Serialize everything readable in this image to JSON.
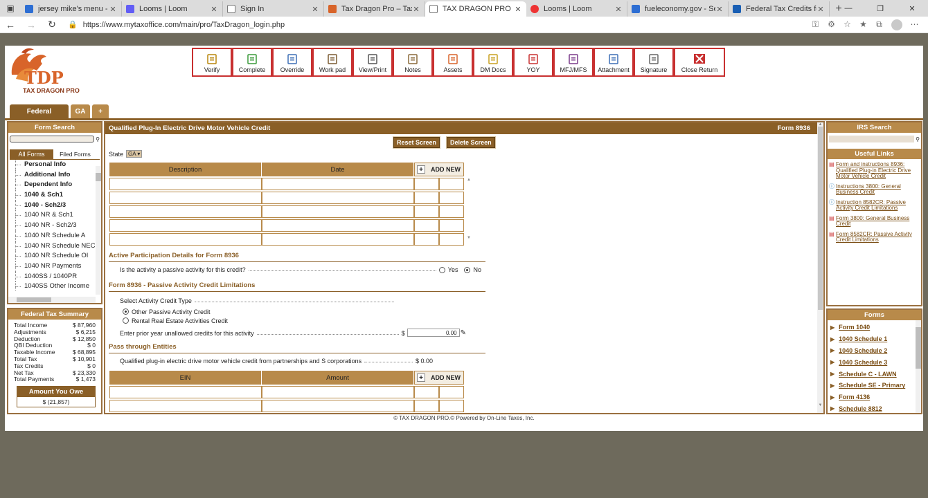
{
  "browser": {
    "tabs": [
      {
        "title": "jersey mike's menu - Searc",
        "fav": "b"
      },
      {
        "title": "Looms | Loom",
        "fav": "loom"
      },
      {
        "title": "Sign In",
        "fav": "page"
      },
      {
        "title": "Tax Dragon Pro – Tax Softw",
        "fav": "dragon"
      },
      {
        "title": "TAX DRAGON PRO",
        "fav": "page",
        "active": true
      },
      {
        "title": "Looms | Loom",
        "fav": "rec"
      },
      {
        "title": "fueleconomy.gov - Search",
        "fav": "b"
      },
      {
        "title": "Federal Tax Credits for All-",
        "fav": "doc"
      }
    ],
    "url": "https://www.mytaxoffice.com/main/pro/TaxDragon_login.php"
  },
  "logo": {
    "text": "TDP",
    "subtext": "TAX DRAGON PRO"
  },
  "toolbar": [
    {
      "label": "Verify",
      "icon": "clipboard-icon"
    },
    {
      "label": "Complete",
      "icon": "check-icon"
    },
    {
      "label": "Override",
      "icon": "pencil-icon"
    },
    {
      "label": "Work pad",
      "icon": "notepad-icon"
    },
    {
      "label": "View/Print",
      "icon": "printer-icon"
    },
    {
      "label": "Notes",
      "icon": "notes-icon"
    },
    {
      "label": "Assets",
      "icon": "chart-icon"
    },
    {
      "label": "DM Docs",
      "icon": "folder-icon"
    },
    {
      "label": "YOY",
      "icon": "yoy-icon"
    },
    {
      "label": "MFJ/MFS",
      "icon": "people-icon"
    },
    {
      "label": "Attachment",
      "icon": "paperclip-icon"
    },
    {
      "label": "Signature",
      "icon": "signature-icon"
    },
    {
      "label": "Close Return",
      "icon": "close-icon"
    }
  ],
  "form_tabs": [
    "Federal",
    "GA",
    "+"
  ],
  "left": {
    "form_search_title": "Form Search",
    "tab_all": "All Forms",
    "tab_filed": "Filed Forms",
    "forms": [
      {
        "label": "Personal Info",
        "bold": true
      },
      {
        "label": "Additional Info",
        "bold": true
      },
      {
        "label": "Dependent Info",
        "bold": true
      },
      {
        "label": "1040 & Sch1",
        "bold": true
      },
      {
        "label": "1040 - Sch2/3",
        "bold": true
      },
      {
        "label": "1040 NR & Sch1",
        "bold": false
      },
      {
        "label": "1040 NR - Sch2/3",
        "bold": false
      },
      {
        "label": "1040 NR Schedule A",
        "bold": false
      },
      {
        "label": "1040 NR Schedule NEC",
        "bold": false
      },
      {
        "label": "1040 NR Schedule OI",
        "bold": false
      },
      {
        "label": "1040 NR Payments",
        "bold": false
      },
      {
        "label": "1040SS / 1040PR",
        "bold": false
      },
      {
        "label": "1040SS Other Income",
        "bold": false
      }
    ],
    "summary_title": "Federal Tax Summary",
    "summary": [
      [
        "Total Income",
        "$ 87,960"
      ],
      [
        "Adjustments",
        "$ 6,215"
      ],
      [
        "Deduction",
        "$ 12,850"
      ],
      [
        "QBI Deduction",
        "$ 0"
      ],
      [
        "Taxable Income",
        "$ 68,895"
      ],
      [
        "Total Tax",
        "$ 10,901"
      ],
      [
        "Tax Credits",
        "$ 0"
      ],
      [
        "Net Tax",
        "$ 23,330"
      ],
      [
        "Total Payments",
        "$ 1,473"
      ]
    ],
    "owe_title": "Amount You Owe",
    "owe_value": "$ (21,857)"
  },
  "main": {
    "title": "Qualified Plug-In Electric Drive Motor Vehicle Credit",
    "form_no": "Form 8936",
    "reset": "Reset Screen",
    "delete": "Delete Screen",
    "state_label": "State",
    "state_value": "GA",
    "table1": {
      "col1": "Description",
      "col2": "Date",
      "add": "ADD NEW"
    },
    "sec1": "Active Participation Details for Form 8936",
    "passive_q": "Is the activity a passive activity for this credit?",
    "yes": "Yes",
    "no": "No",
    "sec2": "Form 8936 - Passive Activity Credit Limitations",
    "credit_type_label": "Select Activity Credit Type",
    "opt1": "Other Passive Activity Credit",
    "opt2": "Rental Real Estate Activities Credit",
    "prior_label": "Enter prior year unallowed credits for this activity",
    "dollar": "$",
    "prior_value": "0.00",
    "sec3": "Pass through Entities",
    "pt_label": "Qualified plug-in electric drive motor vehicle credit from partnerships and S corporations",
    "pt_value": "$ 0.00",
    "table2": {
      "col1": "EIN",
      "col2": "Amount",
      "add": "ADD NEW"
    }
  },
  "right": {
    "irs_title": "IRS Search",
    "links_title": "Useful Links",
    "links": [
      {
        "text": "Form and instructions 8936: Qualified Plug-in Electric Drive Motor Vehicle Credit",
        "type": "pdf"
      },
      {
        "text": "Instructions 3800: General Business Credit",
        "type": "info"
      },
      {
        "text": "Instruction 8582CR: Passive Activity Credit Limitations",
        "type": "info"
      },
      {
        "text": "Form 3800: General Business Credit",
        "type": "pdf"
      },
      {
        "text": "Form 8582CR: Passive Activity Credit Limitations",
        "type": "pdf"
      }
    ],
    "forms_title": "Forms",
    "forms": [
      "Form 1040",
      "1040 Schedule 1",
      "1040 Schedule 2",
      "1040 Schedule 3",
      "Schedule C - LAWN",
      "Schedule SE - Primary",
      "Form 4136",
      "Schedule 8812"
    ]
  },
  "footer": "© TAX DRAGON PRO.© Powered by On-Line Taxes, Inc."
}
